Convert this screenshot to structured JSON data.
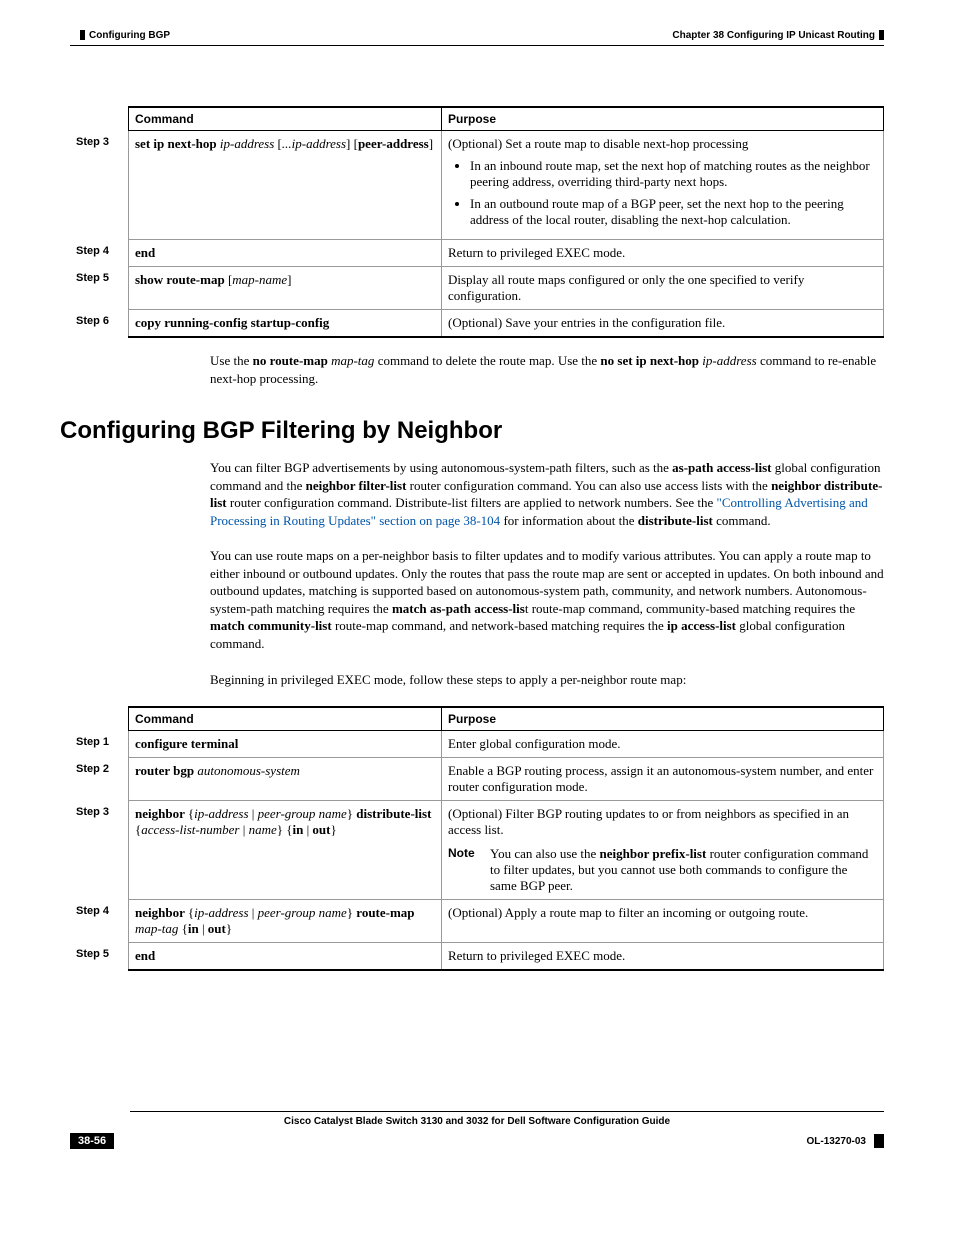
{
  "header": {
    "chapter": "Chapter 38      Configuring IP Unicast Routing",
    "section": "Configuring BGP"
  },
  "table1": {
    "head_command": "Command",
    "head_purpose": "Purpose",
    "step3": "Step 3",
    "step3_cmd_b1": "set ip next-hop ",
    "step3_cmd_i1": "ip-address ",
    "step3_cmd_p1": "[",
    "step3_cmd_i2": "...ip-address",
    "step3_cmd_p2": "] [",
    "step3_cmd_b2": "peer-address",
    "step3_cmd_p3": "]",
    "step3_purpose_top": "(Optional) Set a route map to disable next-hop processing",
    "step3_b1": "In an inbound route map, set the next hop of matching routes as the neighbor peering address, overriding third-party next hops.",
    "step3_b2": "In an outbound route map of a BGP peer, set the next hop to the peering address of the local router, disabling the next-hop calculation.",
    "step4": "Step 4",
    "step4_cmd": "end",
    "step4_purpose": "Return to privileged EXEC mode.",
    "step5": "Step 5",
    "step5_cmd_b": "show route-map ",
    "step5_cmd_p1": "[",
    "step5_cmd_i": "map-name",
    "step5_cmd_p2": "]",
    "step5_purpose": "Display all route maps configured or only the one specified to verify configuration.",
    "step6": "Step 6",
    "step6_cmd": "copy running-config startup-config",
    "step6_purpose": "(Optional) Save your entries in the configuration file."
  },
  "para1": {
    "t1": "Use the ",
    "b1": "no route-map ",
    "i1": "map-tag",
    "t2": " command to delete the route map. Use the ",
    "b2": "no set ip next-hop ",
    "i2": "ip-address",
    "t3": " command to re-enable next-hop processing."
  },
  "heading": "Configuring BGP Filtering by Neighbor",
  "para2": {
    "t1": "You can filter BGP advertisements by using autonomous-system-path filters, such as the ",
    "b1": "as-path access-list",
    "t2": " global configuration command and the ",
    "b2": "neighbor filter-list",
    "t3": " router configuration command. You can also use access lists with the ",
    "b3": "neighbor distribute-list",
    "t4": " router configuration command. Distribute-list filters are applied to network numbers. See the ",
    "link": "\"Controlling Advertising and Processing in Routing Updates\" section on page 38-104",
    "t5": " for information about the ",
    "b4": "distribute-list",
    "t6": " command."
  },
  "para3": {
    "t1": "You can use route maps on a per-neighbor basis to filter updates and to modify various attributes. You can apply a route map to either inbound or outbound updates. Only the routes that pass the route map are sent or accepted in updates. On both inbound and outbound updates, matching is supported based on autonomous-system path, community, and network numbers. Autonomous-system-path matching requires the ",
    "b1": "match as-path access-lis",
    "t2": "t route-map command, community-based matching requires the ",
    "b2": "match community-list",
    "t3": " route-map command, and network-based matching requires the ",
    "b3": "ip access-list",
    "t4": " global configuration command."
  },
  "para4": "Beginning in privileged EXEC mode, follow these steps to apply a per-neighbor route map:",
  "table2": {
    "head_command": "Command",
    "head_purpose": "Purpose",
    "step1": "Step 1",
    "step1_cmd": "configure terminal",
    "step1_purpose": "Enter global configuration mode.",
    "step2": "Step 2",
    "step2_cmd_b": "router bgp ",
    "step2_cmd_i": "autonomous-system",
    "step2_purpose": "Enable a BGP routing process, assign it an autonomous-system number, and enter router configuration mode.",
    "step3": "Step 3",
    "step3_cmd_b1": "neighbor ",
    "step3_cmd_p1": "{",
    "step3_cmd_i1": "ip-address ",
    "step3_cmd_p2": "| ",
    "step3_cmd_i2": "peer-group name",
    "step3_cmd_p3": "} ",
    "step3_cmd_b2": "distribute-list ",
    "step3_cmd_p4": "{",
    "step3_cmd_i3": "access-list-number ",
    "step3_cmd_p5": "| ",
    "step3_cmd_i4": "name",
    "step3_cmd_p6": "} {",
    "step3_cmd_b3": "in ",
    "step3_cmd_p7": "| ",
    "step3_cmd_b4": "out",
    "step3_cmd_p8": "}",
    "step3_purpose": "(Optional) Filter BGP routing updates to or from neighbors as specified in an access list.",
    "step3_note_label": "Note",
    "step3_note_t1": "You can also use the ",
    "step3_note_b1": "neighbor prefix-list",
    "step3_note_t2": " router configuration command to filter updates, but you cannot use both commands to configure the same BGP peer.",
    "step4": "Step 4",
    "step4_cmd_b1": "neighbor ",
    "step4_cmd_p1": "{",
    "step4_cmd_i1": "ip-address ",
    "step4_cmd_p2": "| ",
    "step4_cmd_i2": "peer-group name",
    "step4_cmd_p3": "} ",
    "step4_cmd_b2": "route-map ",
    "step4_cmd_i3": "map-tag ",
    "step4_cmd_p4": "{",
    "step4_cmd_b3": "in ",
    "step4_cmd_p5": "| ",
    "step4_cmd_b4": "out",
    "step4_cmd_p6": "}",
    "step4_purpose": "(Optional) Apply a route map to filter an incoming or outgoing route.",
    "step5": "Step 5",
    "step5_cmd": "end",
    "step5_purpose": "Return to privileged EXEC mode."
  },
  "footer": {
    "title": "Cisco Catalyst Blade Switch 3130 and 3032 for Dell Software Configuration Guide",
    "page": "38-56",
    "doc": "OL-13270-03"
  }
}
